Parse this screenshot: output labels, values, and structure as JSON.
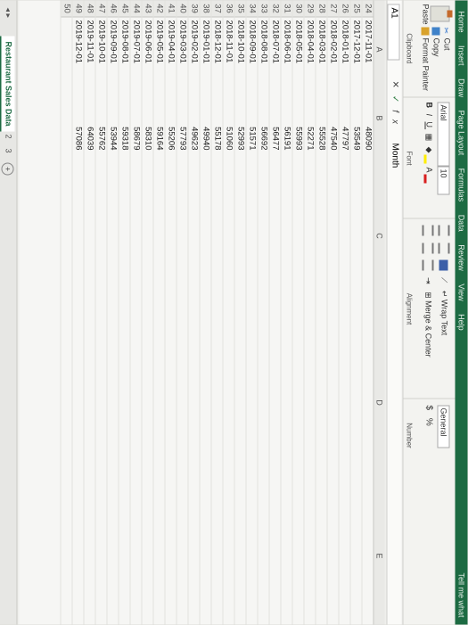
{
  "tabs": [
    "Home",
    "Insert",
    "Draw",
    "Page Layout",
    "Formulas",
    "Data",
    "Review",
    "View",
    "Help"
  ],
  "tell_me": "Tell me what",
  "clipboard": {
    "paste": "Paste",
    "cut": "Cut",
    "copy": "Copy",
    "format_painter": "Format Painter",
    "label": "Clipboard"
  },
  "font": {
    "name": "Arial",
    "size": "10",
    "bold": "B",
    "italic": "I",
    "underline": "U",
    "label": "Font"
  },
  "alignment": {
    "wrap_text": "Wrap Text",
    "merge_center": "Merge & Center",
    "label": "Alignment"
  },
  "number": {
    "format": "General",
    "currency": "$",
    "percent": "%",
    "label": "Number"
  },
  "formula_bar": {
    "name_box": "A1",
    "content": "Month"
  },
  "columns": [
    "A",
    "B",
    "C",
    "D",
    "E"
  ],
  "rows": [
    {
      "n": "24",
      "month": "2017-11-01",
      "sales": "48090"
    },
    {
      "n": "25",
      "month": "2017-12-01",
      "sales": "53549"
    },
    {
      "n": "26",
      "month": "2018-01-01",
      "sales": "47797"
    },
    {
      "n": "27",
      "month": "2018-02-01",
      "sales": "47540"
    },
    {
      "n": "28",
      "month": "2018-03-01",
      "sales": "55528"
    },
    {
      "n": "29",
      "month": "2018-04-01",
      "sales": "52271"
    },
    {
      "n": "30",
      "month": "2018-05-01",
      "sales": "55993"
    },
    {
      "n": "31",
      "month": "2018-06-01",
      "sales": "56191"
    },
    {
      "n": "32",
      "month": "2018-07-01",
      "sales": "56477"
    },
    {
      "n": "33",
      "month": "2018-08-01",
      "sales": "56692"
    },
    {
      "n": "34",
      "month": "2018-09-01",
      "sales": "51571"
    },
    {
      "n": "35",
      "month": "2018-10-01",
      "sales": "52993"
    },
    {
      "n": "36",
      "month": "2018-11-01",
      "sales": "51060"
    },
    {
      "n": "37",
      "month": "2018-12-01",
      "sales": "55178"
    },
    {
      "n": "38",
      "month": "2019-01-01",
      "sales": "49940"
    },
    {
      "n": "39",
      "month": "2019-02-01",
      "sales": "49623"
    },
    {
      "n": "40",
      "month": "2019-03-01",
      "sales": "57793"
    },
    {
      "n": "41",
      "month": "2019-04-01",
      "sales": "55206"
    },
    {
      "n": "42",
      "month": "2019-05-01",
      "sales": "59164"
    },
    {
      "n": "43",
      "month": "2019-06-01",
      "sales": "58310"
    },
    {
      "n": "44",
      "month": "2019-07-01",
      "sales": "58679"
    },
    {
      "n": "45",
      "month": "2019-08-01",
      "sales": "59318"
    },
    {
      "n": "46",
      "month": "2019-09-01",
      "sales": "53944"
    },
    {
      "n": "47",
      "month": "2019-10-01",
      "sales": "55762"
    },
    {
      "n": "48",
      "month": "2019-11-01",
      "sales": "64039"
    },
    {
      "n": "49",
      "month": "2019-12-01",
      "sales": "57086"
    },
    {
      "n": "50",
      "month": "",
      "sales": ""
    }
  ],
  "sheet_tabs": {
    "active": "Restaurant Sales Data",
    "others": [
      "2",
      "3"
    ]
  },
  "colors": {
    "accent": "#1d6b43"
  }
}
